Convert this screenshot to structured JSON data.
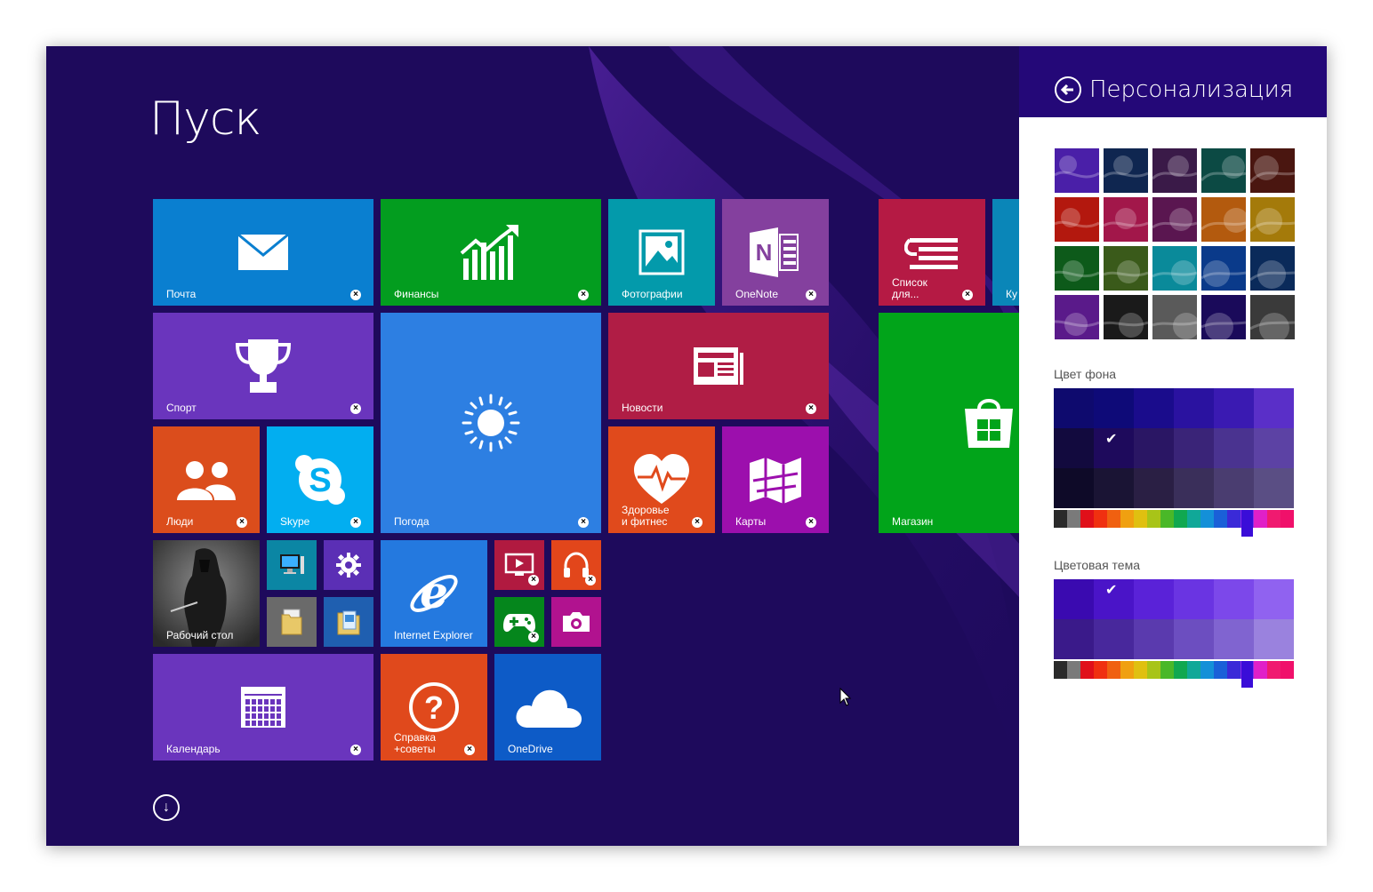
{
  "start": {
    "title": "Пуск",
    "background": "#1e0a5c"
  },
  "tiles": [
    {
      "id": "mail",
      "label": "Почта",
      "color": "#0a7fd0",
      "icon": "mail-icon"
    },
    {
      "id": "finance",
      "label": "Финансы",
      "color": "#039d1f",
      "icon": "finance-chart-icon"
    },
    {
      "id": "photos",
      "label": "Фотографии",
      "color": "#039aab",
      "icon": "photos-icon"
    },
    {
      "id": "onenote",
      "label": "OneNote",
      "color": "#84409e",
      "icon": "onenote-icon"
    },
    {
      "id": "reading",
      "label": "Список\nдля...",
      "color": "#b51a44",
      "icon": "reading-list-icon"
    },
    {
      "id": "cut",
      "label": "Ку",
      "color": "#0a86b8",
      "icon": ""
    },
    {
      "id": "sport",
      "label": "Спорт",
      "color": "#6a35bd",
      "icon": "trophy-icon"
    },
    {
      "id": "weather",
      "label": "Погода",
      "color": "#2d7fe2",
      "icon": "sun-icon"
    },
    {
      "id": "news",
      "label": "Новости",
      "color": "#b01d45",
      "icon": "news-icon"
    },
    {
      "id": "store",
      "label": "Магазин",
      "color": "#01a41a",
      "icon": "store-icon"
    },
    {
      "id": "people",
      "label": "Люди",
      "color": "#db4d1c",
      "icon": "people-icon"
    },
    {
      "id": "skype",
      "label": "Skype",
      "color": "#02aef0",
      "icon": "skype-icon"
    },
    {
      "id": "health",
      "label": "Здоровье\nи фитнес",
      "color": "#e04a1c",
      "icon": "health-icon"
    },
    {
      "id": "maps",
      "label": "Карты",
      "color": "#9c0fad",
      "icon": "maps-icon"
    },
    {
      "id": "desktop",
      "label": "Рабочий стол",
      "color": "#3a3a3a",
      "icon": "desktop-wallpaper"
    },
    {
      "id": "pc",
      "label": "",
      "color": "#0b86a4",
      "icon": "computer-icon"
    },
    {
      "id": "settings",
      "label": "",
      "color": "#5b2fb5",
      "icon": "gear-icon"
    },
    {
      "id": "explorer1",
      "label": "",
      "color": "#6a6a6a",
      "icon": "folder-icon"
    },
    {
      "id": "explorer2",
      "label": "",
      "color": "#1f5fb0",
      "icon": "folder-doc-icon"
    },
    {
      "id": "ie",
      "label": "Internet Explorer",
      "color": "#2479df",
      "icon": "ie-icon"
    },
    {
      "id": "video",
      "label": "",
      "color": "#b11a40",
      "icon": "video-icon"
    },
    {
      "id": "music",
      "label": "",
      "color": "#e2461b",
      "icon": "headphones-icon"
    },
    {
      "id": "games",
      "label": "",
      "color": "#05861c",
      "icon": "gamepad-icon"
    },
    {
      "id": "camera",
      "label": "",
      "color": "#b1128f",
      "icon": "camera-icon"
    },
    {
      "id": "calendar",
      "label": "Календарь",
      "color": "#6a35bd",
      "icon": "calendar-icon"
    },
    {
      "id": "help",
      "label": "Справка\n+советы",
      "color": "#e0491c",
      "icon": "help-icon"
    },
    {
      "id": "onedrive",
      "label": "OneDrive",
      "color": "#0d5bc7",
      "icon": "cloud-icon"
    }
  ],
  "panel": {
    "title": "Персонализация",
    "bg_label": "Цвет фона",
    "theme_label": "Цветовая тема",
    "patterns": [
      [
        "#4a1fa8",
        "#0f2650",
        "#3a1a48",
        "#0c4a44",
        "#4a1610"
      ],
      [
        "#b3180e",
        "#a2174a",
        "#5a1650",
        "#b35a0e",
        "#a47a0a"
      ],
      [
        "#0d5a1a",
        "#3a5a1a",
        "#0a8a9a",
        "#0a3a8a",
        "#0a2a5a"
      ],
      [
        "#5a1a8a",
        "#1a1a1a",
        "#5a5a5a",
        "#1a0a5a",
        "#3a3a3a"
      ]
    ],
    "bg_grid": [
      [
        "#0e0a6e",
        "#0e0a78",
        "#1a0c8c",
        "#2a12a0",
        "#3a1ab2",
        "#5a2fc8"
      ],
      [
        "#120a3e",
        "#1e0a5c",
        "#2a1664",
        "#3a2478",
        "#4a3390",
        "#5c42a4"
      ],
      [
        "#0e0a28",
        "#1a1434",
        "#2a1f44",
        "#3a2f5a",
        "#4a3d70",
        "#5a4e84"
      ]
    ],
    "theme_grid": [
      [
        "#3a0ab0",
        "#4a14c8",
        "#5a22d8",
        "#6a34e2",
        "#7c48ea",
        "#9062f0"
      ],
      [
        "#3a1a8a",
        "#48289c",
        "#5a3aae",
        "#6c4ec0",
        "#8064d0",
        "#9a82de"
      ]
    ],
    "strip": [
      "#2a2a2a",
      "#7a7a7a",
      "#e0101a",
      "#f03010",
      "#f06010",
      "#f0a010",
      "#e0c010",
      "#a8c418",
      "#4ab828",
      "#10a850",
      "#10a898",
      "#1490d8",
      "#1a60d8",
      "#3a2ad8",
      "#8a2ae8",
      "#e020c8",
      "#f01a70",
      "#f0106a"
    ]
  }
}
